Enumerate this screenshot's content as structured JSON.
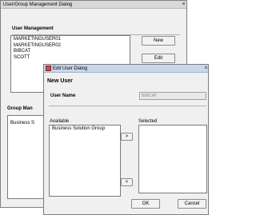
{
  "main_window": {
    "title": "User/Group Management Dialog",
    "close_glyph": "×",
    "user_section": {
      "title": "User Management",
      "users": [
        "MARKETINGUSER01",
        "MARKETINGUSER02",
        "BIBCAT",
        "SCOTT"
      ],
      "new_label": "New",
      "edit_label": "Edit"
    },
    "group_section": {
      "title": "Group Man",
      "groups": [
        "Business S"
      ]
    }
  },
  "edit_dialog": {
    "title": "Edit User Dialog",
    "close_glyph": "×",
    "heading": "New User",
    "user_name_label": "User Name",
    "user_name_value": "BIBCAT",
    "available_label": "Available",
    "selected_label": "Selected",
    "available_items": [
      "Business Solution Group"
    ],
    "selected_items": [],
    "add_label": ">",
    "remove_label": "<",
    "ok_label": "OK",
    "cancel_label": "Cancel"
  }
}
